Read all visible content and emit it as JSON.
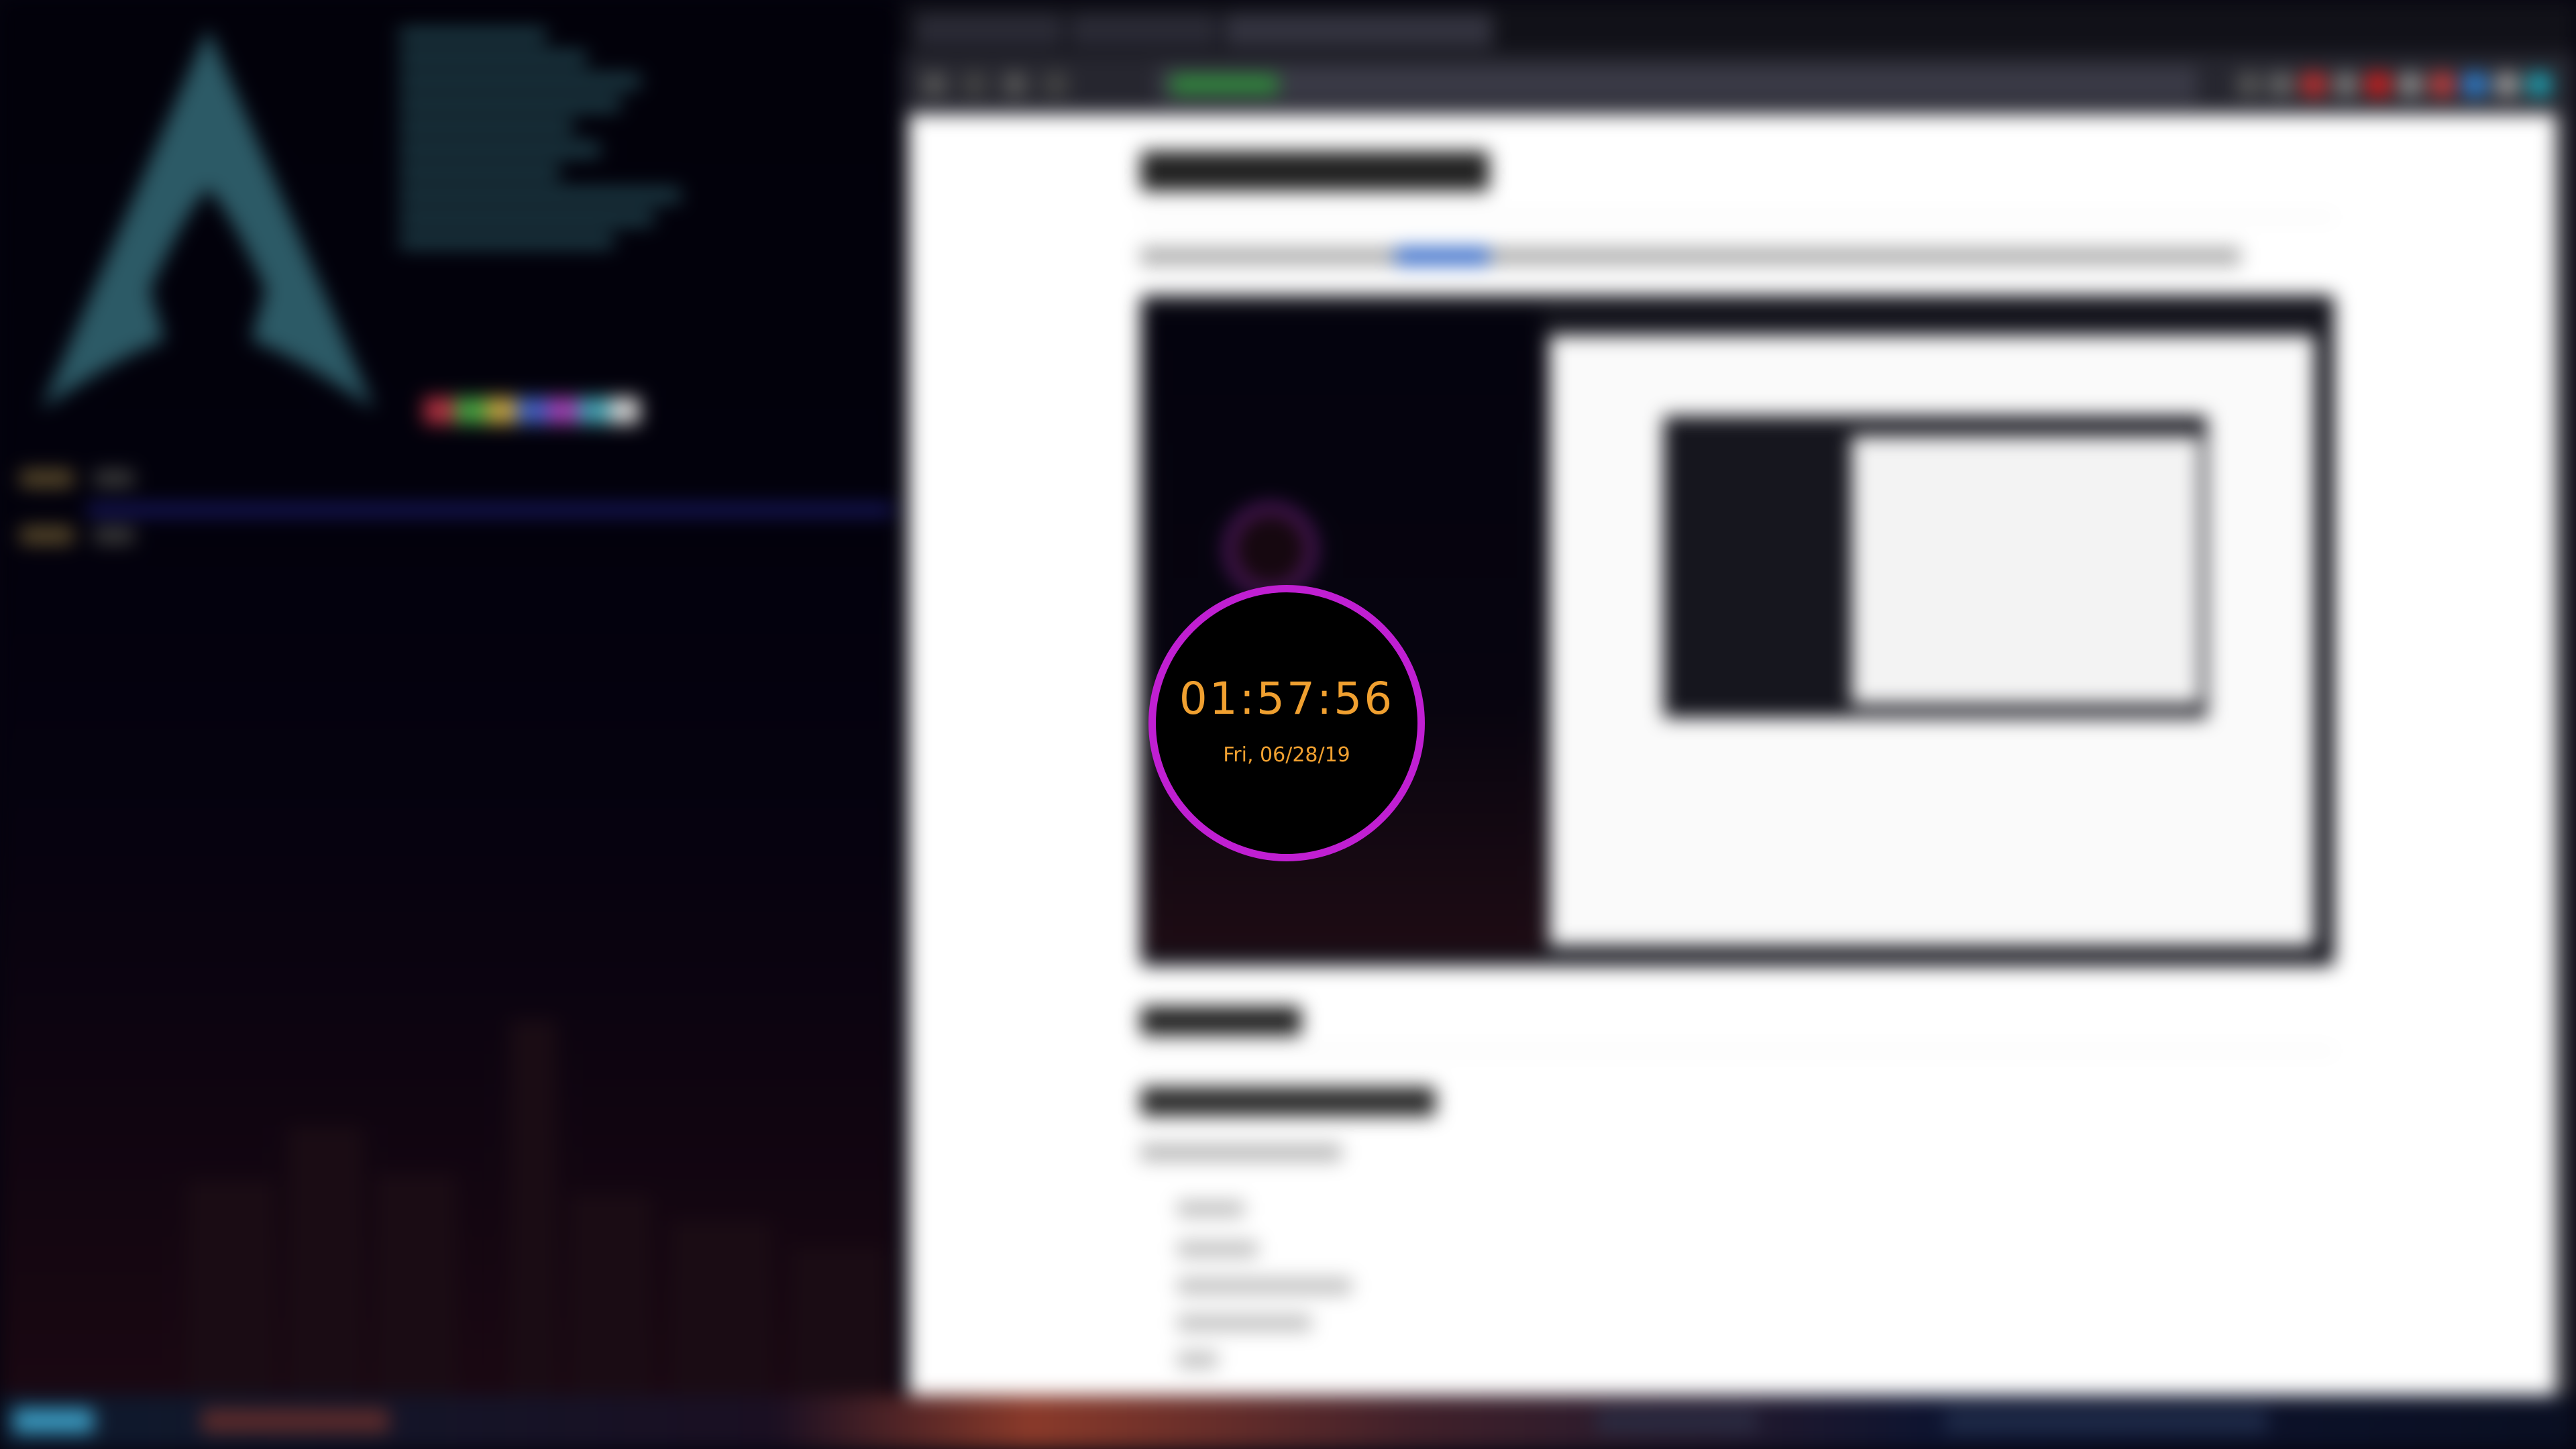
{
  "lock_clock": {
    "time": "01:57:56",
    "date": "Fri, 06/28/19",
    "ring_color": "#c01fd2",
    "text_color": "#f0a030"
  },
  "colors": {
    "terminal_bg": "#05040f",
    "fetch_text": "#2a5560",
    "page_bg": "#ffffff",
    "link": "#3b6ec9"
  },
  "terminal": {
    "swatch_colors": [
      "#b03040",
      "#40a040",
      "#c0a040",
      "#4060c0",
      "#a040b0",
      "#40a0b0",
      "#d0d0d0"
    ]
  },
  "browser": {
    "extension_icon_colors": [
      "#555",
      "#666",
      "#c03030",
      "#777",
      "#d02020",
      "#888",
      "#c04040",
      "#3080d0",
      "#999",
      "#20a0b0"
    ]
  }
}
